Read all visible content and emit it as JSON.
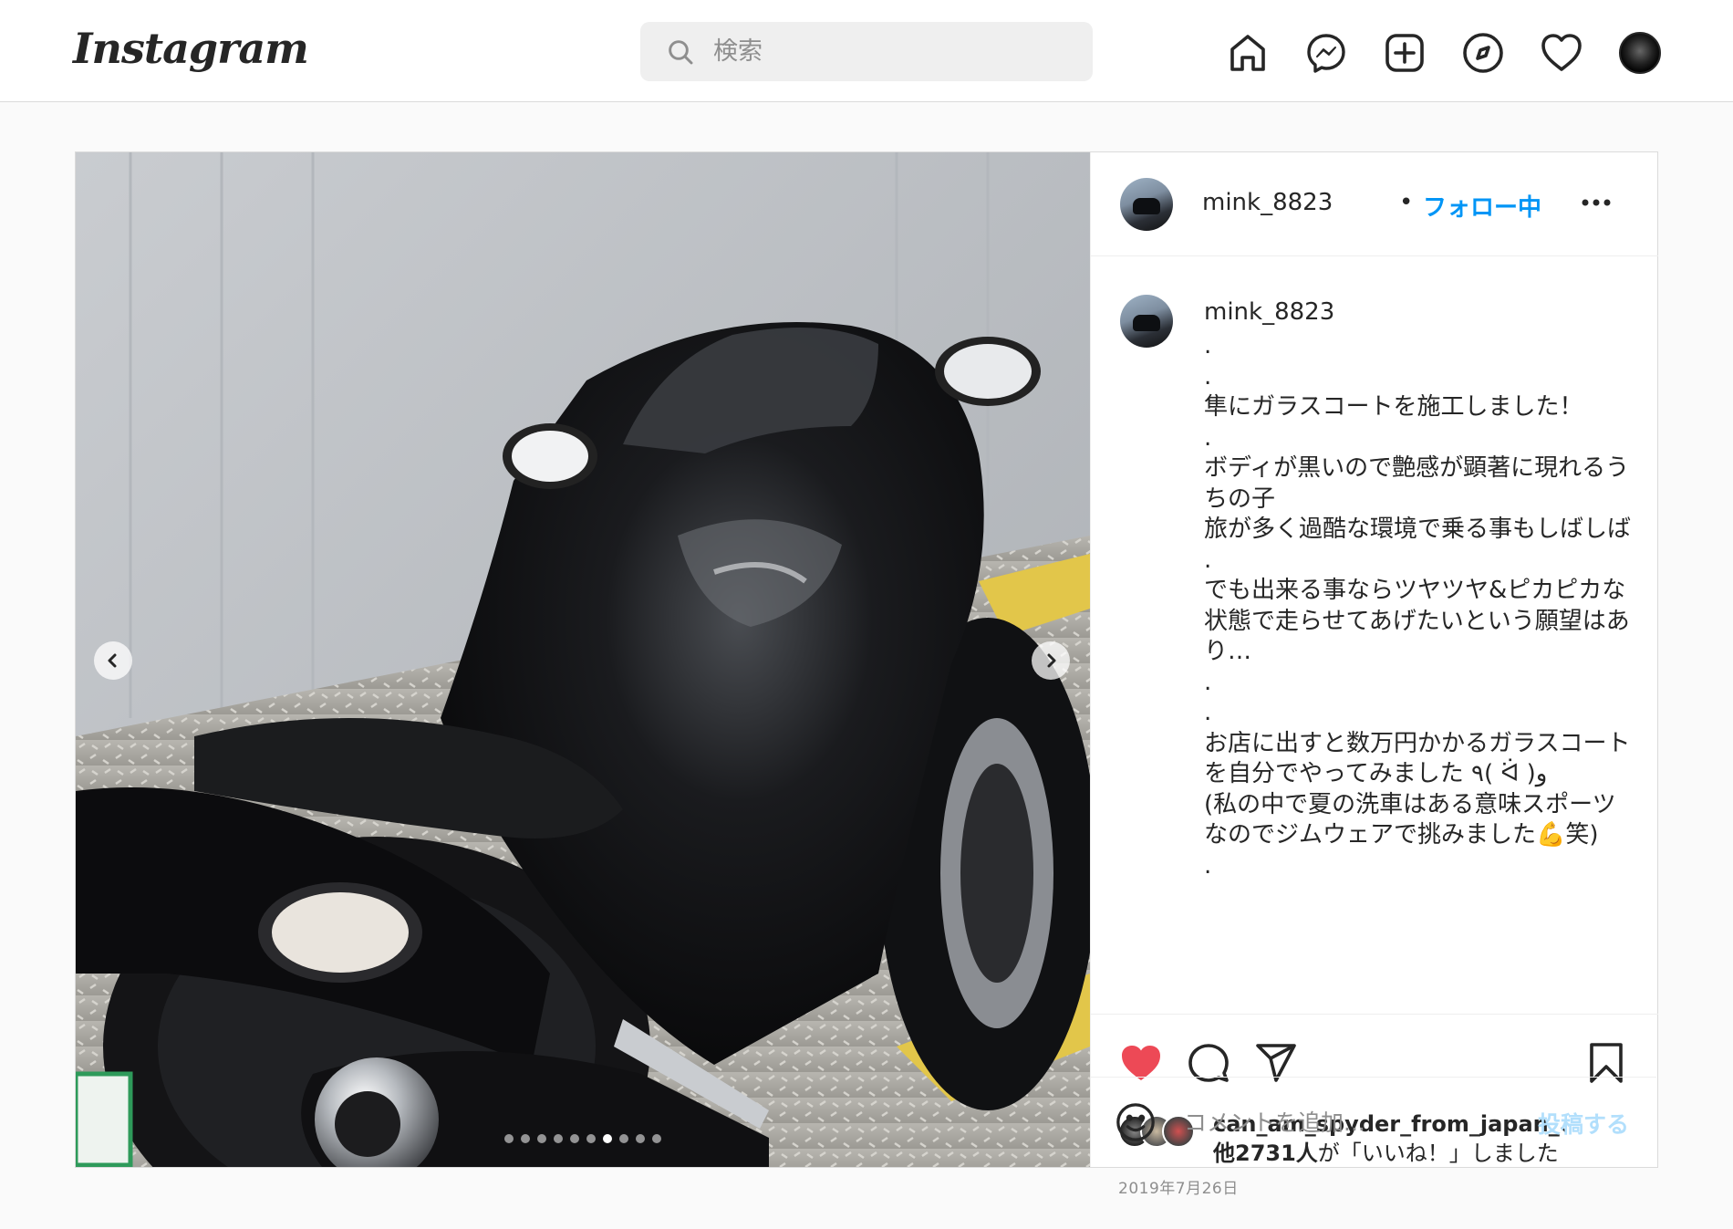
{
  "app": {
    "logo_text": "Instagram"
  },
  "search": {
    "placeholder": "検索"
  },
  "nav": {
    "icons": [
      "home-icon",
      "messenger-icon",
      "new-post-icon",
      "explore-icon",
      "activity-heart-icon",
      "profile-avatar"
    ]
  },
  "post": {
    "author": "mink_8823",
    "separator": "•",
    "follow_status": "フォロー中",
    "caption_username": "mink_8823",
    "caption_text": ".\n.\n隼にガラスコートを施工しました！\n.\nボディが黒いので艶感が顕著に現れるうちの子\n旅が多く過酷な環境で乗る事もしばしば\n.\nでも出来る事ならツヤツヤ&ピカピカな状態で走らせてあげたいという願望はあり…\n.\n.\nお店に出すと数万円かかるガラスコートを自分でやってみました ٩( ᐛ )و\n(私の中で夏の洗車はある意味スポーツなのでジムウェアで挑みました💪笑)\n.",
    "liked": true,
    "likes_user": "can_am_spyder_from_japan_",
    "likes_separator": "、",
    "likes_count": "他2731人",
    "likes_suffix": "が「いいね！」しました",
    "date": "2019年7月26日",
    "carousel": {
      "total": 10,
      "active_index": 6
    },
    "colors": {
      "like_red": "#ed4956",
      "link_blue": "#0095f6",
      "post_button_disabled": "#b2dffc"
    }
  },
  "comment": {
    "placeholder": "コメントを追加...",
    "submit_label": "投稿する"
  }
}
